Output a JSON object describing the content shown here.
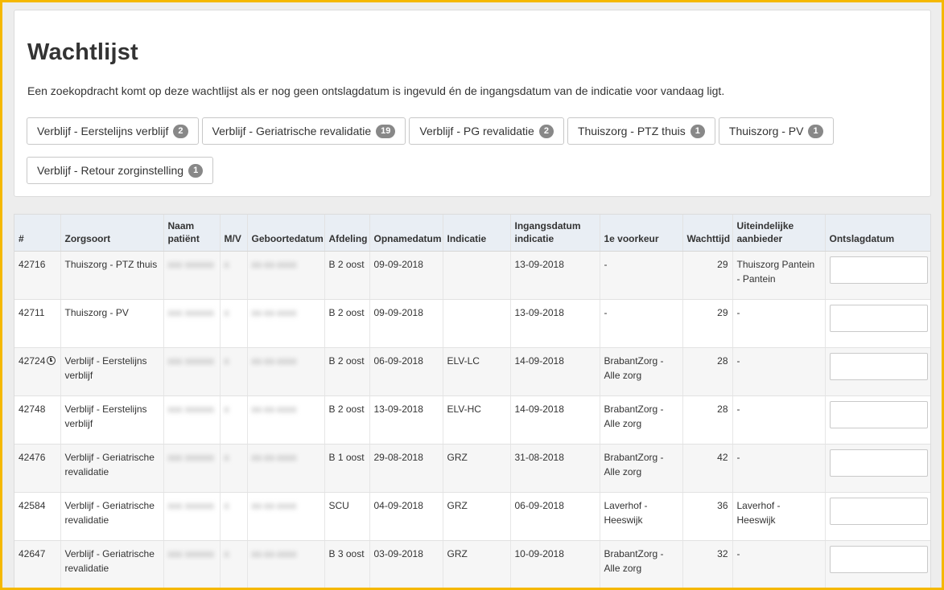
{
  "page": {
    "title": "Wachtlijst",
    "intro": "Een zoekopdracht komt op deze wachtlijst als er nog geen ontslagdatum is ingevuld én de ingangsdatum van de indicatie voor vandaag ligt."
  },
  "filters": [
    {
      "label": "Verblijf - Eerstelijns verblijf",
      "count": "2"
    },
    {
      "label": "Verblijf - Geriatrische revalidatie",
      "count": "19"
    },
    {
      "label": "Verblijf - PG revalidatie",
      "count": "2"
    },
    {
      "label": "Thuiszorg - PTZ thuis",
      "count": "1"
    },
    {
      "label": "Thuiszorg - PV",
      "count": "1"
    },
    {
      "label": "Verblijf - Retour zorginstelling",
      "count": "1"
    }
  ],
  "table": {
    "headers": {
      "id": "#",
      "zorgsoort": "Zorgsoort",
      "naam": "Naam patiënt",
      "mv": "M/V",
      "geboortedatum": "Geboortedatum",
      "afdeling": "Afdeling",
      "opnamedatum": "Opnamedatum",
      "indicatie": "Indicatie",
      "ingangsdatum": "Ingangsdatum indicatie",
      "voorkeur": "1e voorkeur",
      "wachttijd": "Wachttijd",
      "aanbieder": "Uiteindelijke aanbieder",
      "ontslagdatum": "Ontslagdatum"
    },
    "rows": [
      {
        "id": "42716",
        "zorgsoort": "Thuiszorg - PTZ thuis",
        "naam": "xxx xxxxxx",
        "mv": "x",
        "geboortedatum": "xx-xx-xxxx",
        "afdeling": "B 2 oost",
        "opnamedatum": "09-09-2018",
        "indicatie": "",
        "ingangsdatum": "13-09-2018",
        "voorkeur": "-",
        "wachttijd": "29",
        "aanbieder": "Thuiszorg Pantein - Pantein",
        "ontslagdatum": ""
      },
      {
        "id": "42711",
        "zorgsoort": "Thuiszorg - PV",
        "naam": "xxx xxxxxx",
        "mv": "x",
        "geboortedatum": "xx-xx-xxxx",
        "afdeling": "B 2 oost",
        "opnamedatum": "09-09-2018",
        "indicatie": "",
        "ingangsdatum": "13-09-2018",
        "voorkeur": "-",
        "wachttijd": "29",
        "aanbieder": "-",
        "ontslagdatum": ""
      },
      {
        "id": "42724",
        "clock": true,
        "zorgsoort": "Verblijf - Eerstelijns verblijf",
        "naam": "xxx xxxxxx",
        "mv": "x",
        "geboortedatum": "xx-xx-xxxx",
        "afdeling": "B 2 oost",
        "opnamedatum": "06-09-2018",
        "indicatie": "ELV-LC",
        "ingangsdatum": "14-09-2018",
        "voorkeur": "BrabantZorg - Alle zorg",
        "wachttijd": "28",
        "aanbieder": "-",
        "ontslagdatum": ""
      },
      {
        "id": "42748",
        "zorgsoort": "Verblijf - Eerstelijns verblijf",
        "naam": "xxx xxxxxx",
        "mv": "x",
        "geboortedatum": "xx-xx-xxxx",
        "afdeling": "B 2 oost",
        "opnamedatum": "13-09-2018",
        "indicatie": "ELV-HC",
        "ingangsdatum": "14-09-2018",
        "voorkeur": "BrabantZorg - Alle zorg",
        "wachttijd": "28",
        "aanbieder": "-",
        "ontslagdatum": ""
      },
      {
        "id": "42476",
        "zorgsoort": "Verblijf - Geriatrische revalidatie",
        "naam": "xxx xxxxxx",
        "mv": "x",
        "geboortedatum": "xx-xx-xxxx",
        "afdeling": "B 1 oost",
        "opnamedatum": "29-08-2018",
        "indicatie": "GRZ",
        "ingangsdatum": "31-08-2018",
        "voorkeur": "BrabantZorg - Alle zorg",
        "wachttijd": "42",
        "aanbieder": "-",
        "ontslagdatum": ""
      },
      {
        "id": "42584",
        "zorgsoort": "Verblijf - Geriatrische revalidatie",
        "naam": "xxx xxxxxx",
        "mv": "x",
        "geboortedatum": "xx-xx-xxxx",
        "afdeling": "SCU",
        "opnamedatum": "04-09-2018",
        "indicatie": "GRZ",
        "ingangsdatum": "06-09-2018",
        "voorkeur": "Laverhof - Heeswijk",
        "wachttijd": "36",
        "aanbieder": "Laverhof - Heeswijk",
        "ontslagdatum": ""
      },
      {
        "id": "42647",
        "zorgsoort": "Verblijf - Geriatrische revalidatie",
        "naam": "xxx xxxxxx",
        "mv": "x",
        "geboortedatum": "xx-xx-xxxx",
        "afdeling": "B 3 oost",
        "opnamedatum": "03-09-2018",
        "indicatie": "GRZ",
        "ingangsdatum": "10-09-2018",
        "voorkeur": "BrabantZorg - Alle zorg",
        "wachttijd": "32",
        "aanbieder": "-",
        "ontslagdatum": ""
      }
    ]
  }
}
